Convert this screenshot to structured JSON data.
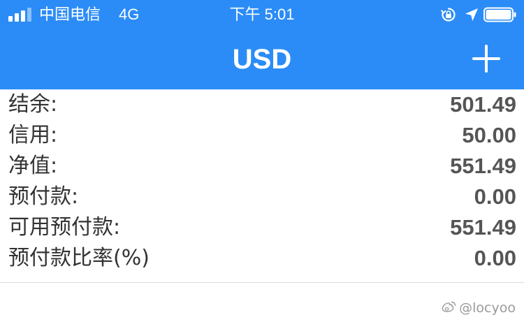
{
  "status_bar": {
    "carrier": "中国电信",
    "network": "4G",
    "time": "下午 5:01",
    "signal_bars_active": 3,
    "signal_bars_total": 4,
    "battery_level": 1.0
  },
  "nav": {
    "title": "USD",
    "add_icon": "plus-icon"
  },
  "account": {
    "rows": [
      {
        "label": "结余:",
        "value": "501.49"
      },
      {
        "label": "信用:",
        "value": "50.00"
      },
      {
        "label": "净值:",
        "value": "551.49"
      },
      {
        "label": "预付款:",
        "value": "0.00"
      },
      {
        "label": "可用预付款:",
        "value": "551.49"
      },
      {
        "label": "预付款比率(%)",
        "value": "0.00"
      }
    ]
  },
  "watermark": {
    "text": "@locyoo"
  },
  "colors": {
    "header_blue": "#2b8cf7",
    "label_text": "#333333",
    "value_text": "#555555",
    "divider": "#d9d9d9"
  }
}
